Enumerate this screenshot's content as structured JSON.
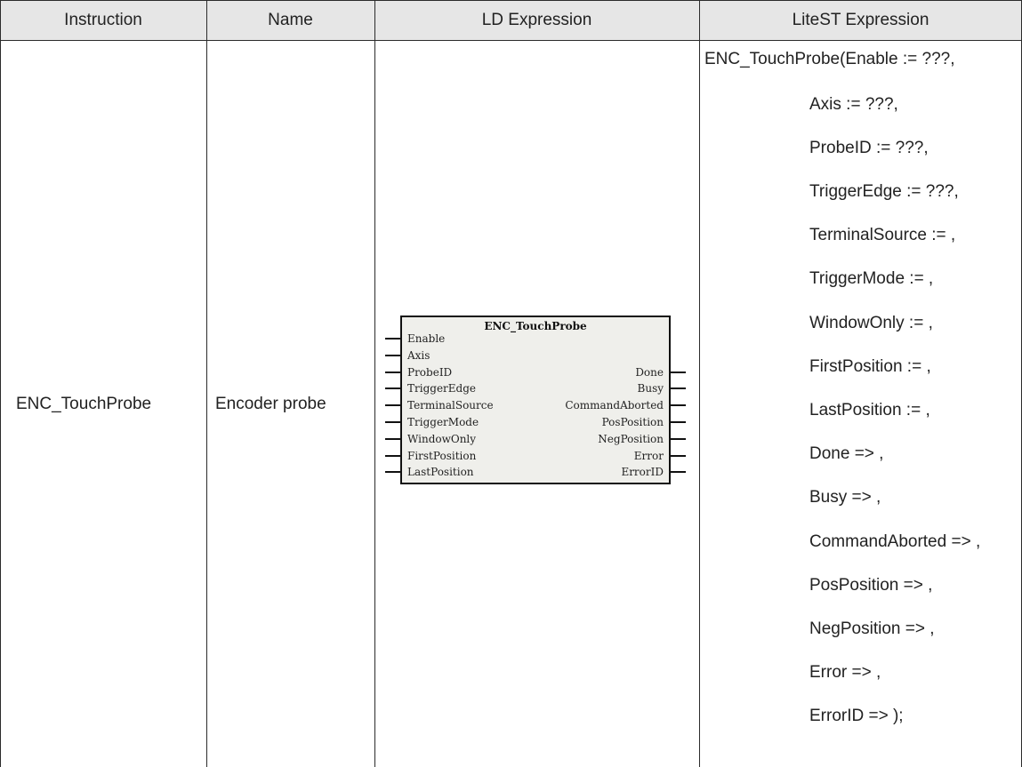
{
  "table": {
    "headers": [
      "Instruction",
      "Name",
      "LD Expression",
      "LiteST Expression"
    ],
    "row": {
      "instruction": "ENC_TouchProbe",
      "name": "Encoder probe"
    }
  },
  "function_block": {
    "title": "ENC_TouchProbe",
    "inputs": [
      "Enable",
      "Axis",
      "ProbeID",
      "TriggerEdge",
      "TerminalSource",
      "TriggerMode",
      "WindowOnly",
      "FirstPosition",
      "LastPosition"
    ],
    "outputs": [
      "Done",
      "Busy",
      "CommandAborted",
      "PosPosition",
      "NegPosition",
      "Error",
      "ErrorID"
    ]
  },
  "litest": {
    "first_line": "ENC_TouchProbe(Enable := ???,",
    "params": [
      "Axis := ???,",
      "ProbeID := ???,",
      "TriggerEdge := ???,",
      "TerminalSource := ,",
      "TriggerMode := ,",
      "WindowOnly := ,",
      "FirstPosition := ,",
      "LastPosition := ,",
      "Done => ,",
      "Busy => ,",
      "CommandAborted => ,",
      "PosPosition => ,",
      "NegPosition => ,",
      "Error => ,",
      "ErrorID => );"
    ]
  }
}
